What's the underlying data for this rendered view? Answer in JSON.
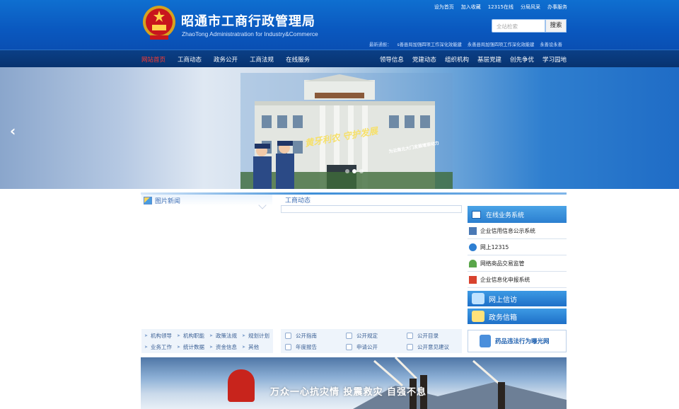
{
  "header": {
    "title": "昭通市工商行政管理局",
    "subtitle": "ZhaoTong Administratration for Industry&Commerce",
    "top_links": [
      "设为首页",
      "加入收藏",
      "12315在线",
      "分局风采",
      "办事服务"
    ],
    "search": {
      "placeholder": "全站检索",
      "button": "搜索"
    },
    "ticker": {
      "lead": "最新通报：",
      "items": [
        "s善县局加强四项工作深化效能建",
        "永善县局加强四项工作深化效能建",
        "永善设永善"
      ]
    }
  },
  "nav": {
    "left": [
      "网站首页",
      "工商动态",
      "政务公开",
      "工商法规",
      "在线服务"
    ],
    "right": [
      "领导信息",
      "党建动态",
      "组织机构",
      "基层党建",
      "创先争优",
      "学习园地"
    ]
  },
  "banner": {
    "slogan": "黄牙利农 守护发展",
    "slogan_sub": "为云南北大门发展增添动力",
    "dots": 3,
    "active_dot": 1
  },
  "sections": {
    "photo_news": "图片新闻",
    "business_news": "工商动态"
  },
  "quick_links_a": [
    [
      "机构领导",
      "机构职能",
      "政策法规",
      "规划计划"
    ],
    [
      "业务工作",
      "统计数据",
      "资金信息",
      "其他"
    ]
  ],
  "quick_links_b": [
    [
      "公开指南",
      "公开规定",
      "公开目录"
    ],
    [
      "年度报告",
      "申请公开",
      "公开意见建议"
    ]
  ],
  "services": {
    "title": "在线业务系统",
    "items": [
      "企业信用信息公示系统",
      "网上12315",
      "网络商品交易监管",
      "企业信息化申报系统"
    ],
    "letters": "网上信访",
    "mailbox": "政务信箱",
    "drug": "药品违法行为曝光网"
  },
  "bottom_banner": {
    "text": "万众一心抗灾情 投震救灾 自强不息"
  }
}
